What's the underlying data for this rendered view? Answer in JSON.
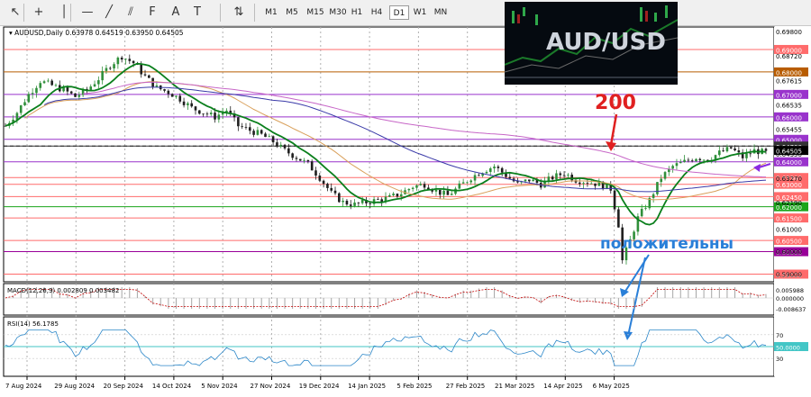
{
  "toolbar": {
    "icons": [
      "cursor-icon",
      "crosshair-icon",
      "vertical-line-icon",
      "horizontal-line-icon",
      "trendline-icon",
      "equidistant-channel-icon",
      "fibonacci-icon",
      "text-icon",
      "text-label-icon",
      "arrows-icon"
    ],
    "timeframes": [
      "M1",
      "M5",
      "M15",
      "M30",
      "H1",
      "H4",
      "D1",
      "W1",
      "MN"
    ],
    "active_timeframe": "D1"
  },
  "chart_info": {
    "symbol": "AUDUSD,Daily",
    "ohlc": "0.63978 0.64519 0.63950 0.64505"
  },
  "thumbnail_title": "AUD/USD",
  "annotations": {
    "ma_label": "200",
    "positive_label": "положительны"
  },
  "colors": {
    "candle_up": "#2f8f3a",
    "candle_down": "#1f1f1f",
    "ma_fast": "#0a7f1c",
    "ma_mid": "#d9a05b",
    "ma_slow": "#3a3aa8",
    "ma_200": "#c766c7",
    "macd_signal": "#c00000",
    "macd_hist": "#a6a6a6",
    "rsi_line": "#2a86c8",
    "rsi_level": "#43c6c6",
    "arrow_red": "#e02020",
    "arrow_blue": "#2a7fd8",
    "arrow_purple": "#8a2be2"
  },
  "chart_data": {
    "type": "candlestick",
    "price_axis": {
      "range": [
        0.587,
        0.7
      ],
      "ticks": [
        "0.69800",
        "0.68720",
        "0.67615",
        "0.66535",
        "0.65455",
        "0.64350",
        "0.63270",
        "0.62190",
        "0.61000",
        "0.60000",
        "0.59000"
      ]
    },
    "horizontal_levels": [
      {
        "value": "0.69000",
        "color": "#ff6b6b"
      },
      {
        "value": "0.68000",
        "color": "#b85c00"
      },
      {
        "value": "0.67000",
        "color": "#9933cc"
      },
      {
        "value": "0.66000",
        "color": "#9933cc"
      },
      {
        "value": "0.65000",
        "color": "#9933cc"
      },
      {
        "value": "0.64700",
        "color": "#333333"
      },
      {
        "value": "0.64000",
        "color": "#9933cc"
      },
      {
        "value": "0.63300",
        "color": "#ff6b6b"
      },
      {
        "value": "0.63000",
        "color": "#ff6b6b"
      },
      {
        "value": "0.62450",
        "color": "#ff6b6b"
      },
      {
        "value": "0.62000",
        "color": "#1aa51a"
      },
      {
        "value": "0.61500",
        "color": "#ff6b6b"
      },
      {
        "value": "0.60500",
        "color": "#ff6b6b"
      },
      {
        "value": "0.60000",
        "color": "#990099"
      },
      {
        "value": "0.59000",
        "color": "#ff6b6b"
      }
    ],
    "current_price": "0.64505",
    "x_ticks": [
      "7 Aug 2024",
      "29 Aug 2024",
      "20 Sep 2024",
      "14 Oct 2024",
      "5 Nov 2024",
      "27 Nov 2024",
      "19 Dec 2024",
      "14 Jan 2025",
      "5 Feb 2025",
      "27 Feb 2025",
      "21 Mar 2025",
      "14 Apr 2025",
      "6 May 2025"
    ],
    "close_path": [
      [
        0,
        0.656
      ],
      [
        3,
        0.662
      ],
      [
        6,
        0.67
      ],
      [
        9,
        0.676
      ],
      [
        12,
        0.674
      ],
      [
        15,
        0.672
      ],
      [
        18,
        0.669
      ],
      [
        21,
        0.672
      ],
      [
        24,
        0.677
      ],
      [
        27,
        0.683
      ],
      [
        30,
        0.687
      ],
      [
        33,
        0.684
      ],
      [
        36,
        0.678
      ],
      [
        39,
        0.673
      ],
      [
        42,
        0.671
      ],
      [
        45,
        0.668
      ],
      [
        48,
        0.664
      ],
      [
        51,
        0.662
      ],
      [
        54,
        0.66
      ],
      [
        57,
        0.663
      ],
      [
        60,
        0.656
      ],
      [
        63,
        0.654
      ],
      [
        66,
        0.652
      ],
      [
        69,
        0.649
      ],
      [
        72,
        0.645
      ],
      [
        75,
        0.642
      ],
      [
        78,
        0.639
      ],
      [
        81,
        0.633
      ],
      [
        84,
        0.626
      ],
      [
        87,
        0.622
      ],
      [
        90,
        0.621
      ],
      [
        93,
        0.622
      ],
      [
        96,
        0.623
      ],
      [
        99,
        0.624
      ],
      [
        102,
        0.626
      ],
      [
        105,
        0.629
      ],
      [
        108,
        0.63
      ],
      [
        111,
        0.627
      ],
      [
        114,
        0.625
      ],
      [
        117,
        0.629
      ],
      [
        120,
        0.633
      ],
      [
        123,
        0.636
      ],
      [
        126,
        0.638
      ],
      [
        129,
        0.634
      ],
      [
        132,
        0.63
      ],
      [
        135,
        0.632
      ],
      [
        138,
        0.63
      ],
      [
        141,
        0.633
      ],
      [
        144,
        0.635
      ],
      [
        147,
        0.632
      ],
      [
        150,
        0.631
      ],
      [
        153,
        0.63
      ],
      [
        156,
        0.628
      ],
      [
        158,
        0.612
      ],
      [
        159,
        0.596
      ],
      [
        161,
        0.605
      ],
      [
        163,
        0.615
      ],
      [
        166,
        0.623
      ],
      [
        169,
        0.633
      ],
      [
        172,
        0.638
      ],
      [
        175,
        0.64
      ],
      [
        178,
        0.642
      ],
      [
        181,
        0.641
      ],
      [
        184,
        0.644
      ],
      [
        187,
        0.646
      ],
      [
        190,
        0.642
      ],
      [
        193,
        0.645
      ],
      [
        196,
        0.644
      ]
    ],
    "macd": {
      "label": "MACD(12,26,9) 0.002809 0.003482",
      "ticks": [
        "0.005988",
        "0.000000",
        "-0.008637"
      ]
    },
    "rsi": {
      "label": "RSI(14) 56.1785",
      "ticks": [
        "70",
        "50.0000",
        "30"
      ]
    }
  }
}
